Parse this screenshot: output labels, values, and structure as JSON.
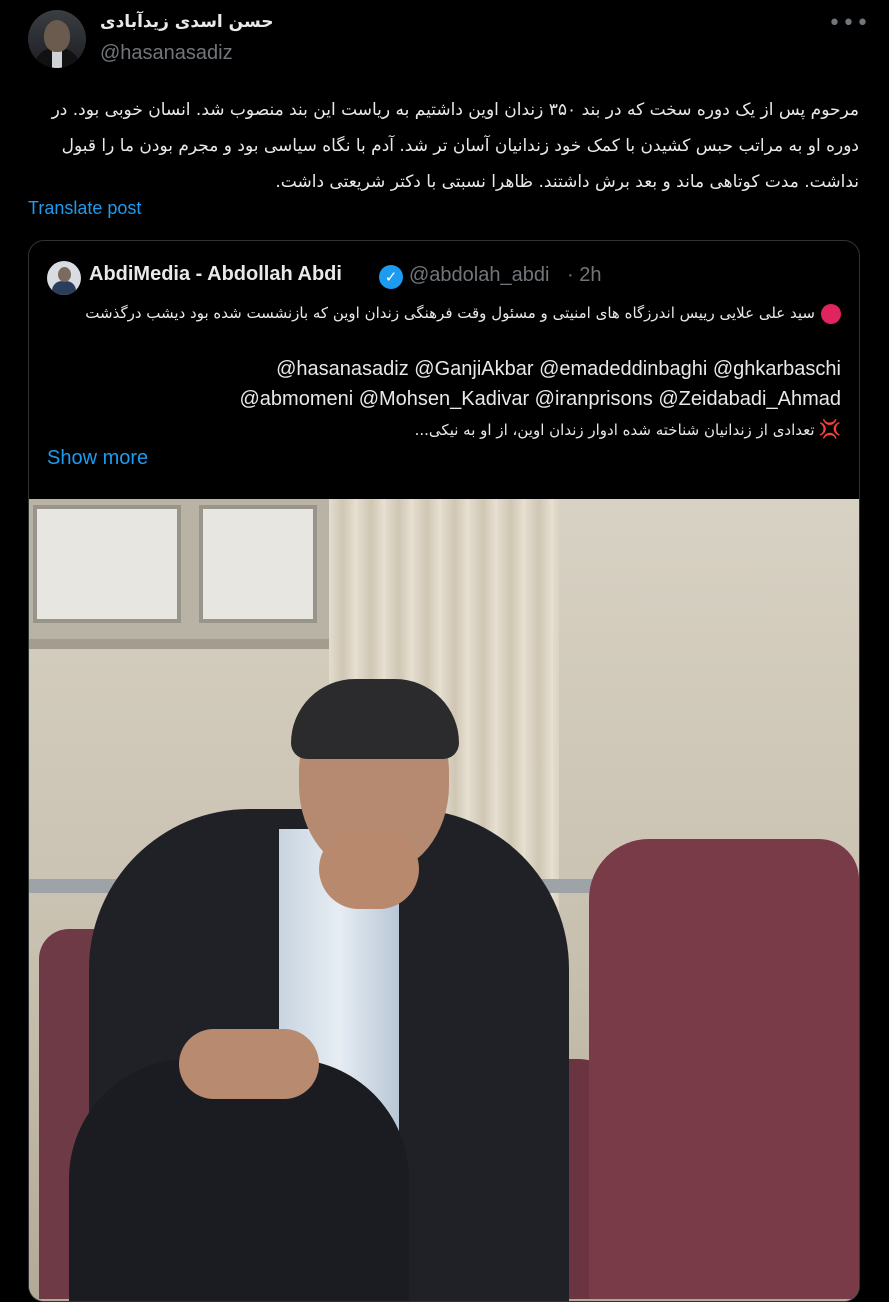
{
  "post": {
    "author_name": "حسن اسدی زیدآبادی",
    "author_handle": "@hasanasadiz",
    "more_icon": "more-horizontal-icon",
    "text": "مرحوم پس از یک دوره سخت که در بند ۳۵۰ زندان اوین داشتیم به ریاست این بند منصوب شد. انسان خوبی بود. در دوره او به مراتب حبس کشیدن با کمک خود زندانیان آسان تر شد. آدم با نگاه سیاسی بود و مجرم بودن ما را قبول نداشت. مدت کوتاهی ماند و بعد برش داشتند. ظاهرا نسبتی با دکتر شریعتی داشت.",
    "translate_label": "Translate post"
  },
  "quote": {
    "author_name": "AbdiMedia - Abdollah Abdi",
    "verified_icon": "verified-badge-icon",
    "author_handle": "@abdolah_abdi",
    "time": "· 2h",
    "line1": "سید علی علایی رییس اندرزگاه های امنیتی و مسئول وقت فرهنگی زندان اوین که بازنشست شده بود دیشب درگذشت",
    "mentions_line1": "@hasanasadiz @GanjiAkbar @emadeddinbaghi @ghkarbaschi",
    "mentions_line2": "@abmomeni @Mohsen_Kadivar @iranprisons @Zeidabadi_Ahmad",
    "line2": "تعدادی از زندانیان شناخته شده ادوار زندان اوین، از او به نیکی...",
    "show_more_label": "Show more"
  },
  "colors": {
    "background": "#000000",
    "text": "#e7e9ea",
    "secondary": "#71767b",
    "link": "#1d9bf0",
    "border": "#2f3336"
  }
}
